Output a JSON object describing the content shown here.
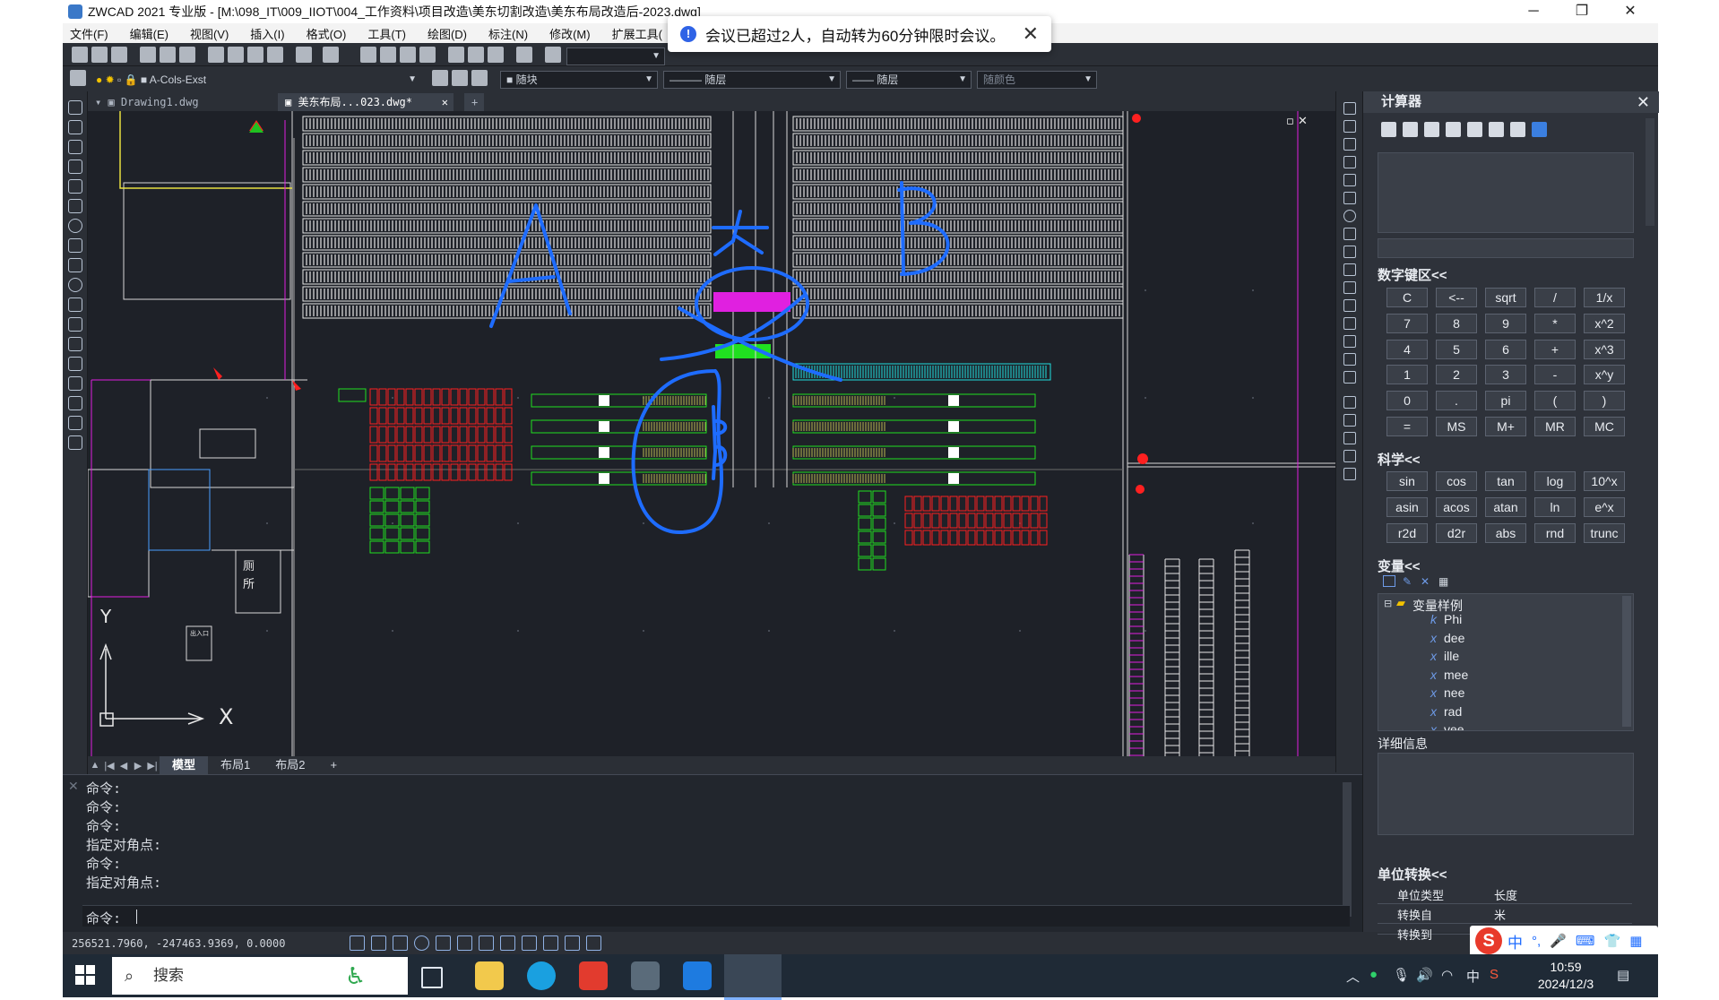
{
  "window": {
    "title": "ZWCAD 2021 专业版 - [M:\\098_IT\\009_IIOT\\004_工作资料\\项目改造\\美东切割改造\\美东布局改造后-2023.dwg]",
    "min_glyph": "─",
    "max_glyph": "❐",
    "close_glyph": "✕"
  },
  "menu": [
    "文件(F)",
    "编辑(E)",
    "视图(V)",
    "插入(I)",
    "格式(O)",
    "工具(T)",
    "绘图(D)",
    "标注(N)",
    "修改(M)",
    "扩展工具("
  ],
  "notification": {
    "icon": "!",
    "text": "会议已超过2人，自动转为60分钟限时会议。",
    "close": "✕"
  },
  "toolbar": {
    "layer_name": "A-Cols-Exst",
    "color_combo": "随块",
    "linetype_combo": "——— 随层",
    "lineweight_combo": "—— 随层",
    "plotstyle_combo": "随颜色"
  },
  "doc_tabs": [
    {
      "label": "Drawing1.dwg",
      "active": false
    },
    {
      "label": "美东布局...023.dwg*",
      "active": true
    }
  ],
  "doc_tab_close": "✕",
  "doc_tab_new": "+",
  "canvas": {
    "hand_letter_a": "A",
    "hand_letter_b": "B",
    "hand_big": "大",
    "room_label_1": "厕",
    "room_label_2": "所",
    "axis_y": "Y",
    "axis_x": "X",
    "small_box_label": "出入口"
  },
  "layout_tabs": [
    {
      "label": "模型",
      "active": true
    },
    {
      "label": "布局1",
      "active": false
    },
    {
      "label": "布局2",
      "active": false
    },
    {
      "label": "+",
      "active": false
    }
  ],
  "command_history": [
    "命令:",
    "命令:",
    "命令:",
    "指定对角点:",
    "命令:",
    "指定对角点:"
  ],
  "command_prompt": "命令:",
  "coords": "256521.7960, -247463.9369, 0.0000",
  "calculator": {
    "title": "计算器",
    "close": "✕",
    "numpad_title": "数字键区<<",
    "numpad": [
      [
        "C",
        "<--",
        "sqrt",
        "/",
        "1/x"
      ],
      [
        "7",
        "8",
        "9",
        "*",
        "x^2"
      ],
      [
        "4",
        "5",
        "6",
        "+",
        "x^3"
      ],
      [
        "1",
        "2",
        "3",
        "-",
        "x^y"
      ],
      [
        "0",
        ".",
        "pi",
        "(",
        ")"
      ],
      [
        "=",
        "MS",
        "M+",
        "MR",
        "MC"
      ]
    ],
    "science_title": "科学<<",
    "science": [
      [
        "sin",
        "cos",
        "tan",
        "log",
        "10^x"
      ],
      [
        "asin",
        "acos",
        "atan",
        "ln",
        "e^x"
      ],
      [
        "r2d",
        "d2r",
        "abs",
        "rnd",
        "trunc"
      ]
    ],
    "variables_title": "变量<<",
    "variables_folder": "变量样例",
    "variables": [
      {
        "kind": "k",
        "name": "Phi"
      },
      {
        "kind": "x",
        "name": "dee"
      },
      {
        "kind": "x",
        "name": "ille"
      },
      {
        "kind": "x",
        "name": "mee"
      },
      {
        "kind": "x",
        "name": "nee"
      },
      {
        "kind": "x",
        "name": "rad"
      },
      {
        "kind": "x",
        "name": "vee"
      }
    ],
    "details_title": "详细信息",
    "unit_title": "单位转换<<",
    "unit_rows": [
      {
        "key": "单位类型",
        "value": "长度"
      },
      {
        "key": "转换自",
        "value": "米"
      },
      {
        "key": "转换到",
        "value": ""
      }
    ]
  },
  "taskbar": {
    "search": "搜索",
    "time": "10:59",
    "date": "2024/12/3",
    "ime_lang": "中",
    "ime_brand": "S"
  },
  "colors": {
    "cad_bg": "#1e2128",
    "rack_white": "#e6e6e6",
    "red": "#ff2020",
    "green": "#20e020",
    "cyan": "#20e0e0",
    "magenta": "#e020e0",
    "ink_blue": "#1e6cff"
  }
}
